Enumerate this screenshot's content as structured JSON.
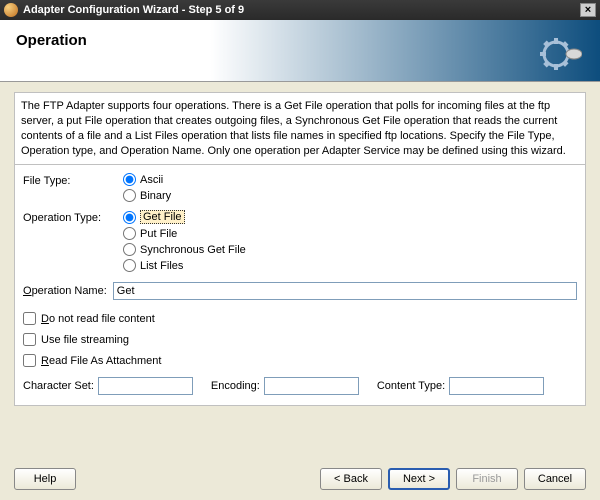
{
  "window": {
    "title": "Adapter Configuration Wizard - Step 5 of 9"
  },
  "header": {
    "title": "Operation"
  },
  "description": "The FTP Adapter supports four operations.  There is a Get File operation that polls for incoming files at the ftp server, a put File operation that creates outgoing files, a Synchronous Get File operation that reads the current contents of a file and a List Files operation that lists file names in specified ftp locations.  Specify the File Type, Operation type, and Operation Name.  Only one operation per Adapter Service may be defined using this wizard.",
  "fileType": {
    "label": "File Type:",
    "options": {
      "ascii": "Ascii",
      "binary": "Binary"
    },
    "selected": "ascii"
  },
  "operationType": {
    "label": "Operation Type:",
    "options": {
      "get": "Get File",
      "put": "Put File",
      "sync": "Synchronous Get File",
      "list": "List Files"
    },
    "selected": "get"
  },
  "operationName": {
    "label_prefix": "O",
    "label_rest": "peration Name:",
    "value": "Get"
  },
  "checks": {
    "noRead": {
      "prefix": "D",
      "rest": "o not read file content",
      "checked": false
    },
    "streaming": {
      "label": "Use file streaming",
      "checked": false
    },
    "attachment": {
      "prefix": "R",
      "rest": "ead File As Attachment",
      "checked": false
    }
  },
  "extra": {
    "charset": {
      "label": "Character Set:",
      "value": ""
    },
    "encoding": {
      "label": "Encoding:",
      "value": ""
    },
    "contentType": {
      "label": "Content Type:",
      "value": ""
    }
  },
  "buttons": {
    "help": "Help",
    "back": "< Back",
    "next": "Next >",
    "finish": "Finish",
    "cancel": "Cancel"
  }
}
